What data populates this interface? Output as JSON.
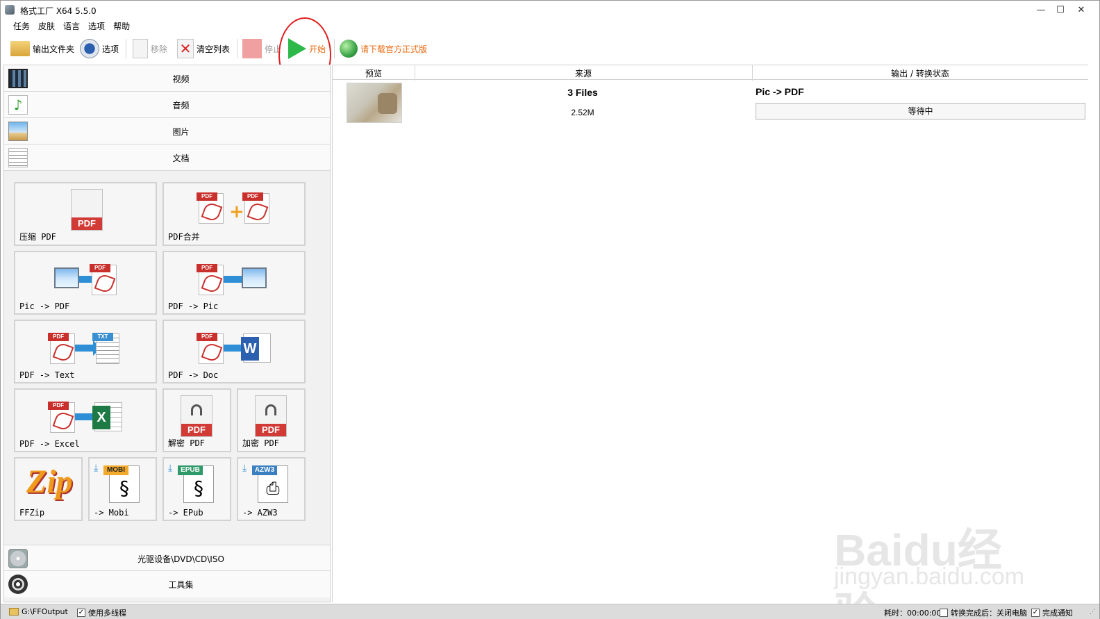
{
  "window": {
    "title": "格式工厂 X64 5.5.0",
    "minimize": "—",
    "maximize": "☐",
    "close": "✕"
  },
  "menu": [
    "任务",
    "皮肤",
    "语言",
    "选项",
    "帮助"
  ],
  "toolbar": {
    "output_folder": "输出文件夹",
    "options": "选项",
    "remove": "移除",
    "clear_list": "清空列表",
    "stop": "停止",
    "start": "开始",
    "download": "请下载官方正式版"
  },
  "categories": {
    "video": "视频",
    "audio": "音频",
    "image": "图片",
    "document": "文档",
    "disc": "光驱设备\\DVD\\CD\\ISO",
    "tools": "工具集"
  },
  "tiles": {
    "compress_pdf": "压缩 PDF",
    "pdf_merge": "PDF合并",
    "pic_to_pdf": "Pic -> PDF",
    "pdf_to_pic": "PDF -> Pic",
    "pdf_to_text": "PDF -> Text",
    "pdf_to_doc": "PDF -> Doc",
    "pdf_to_excel": "PDF -> Excel",
    "decrypt_pdf": "解密 PDF",
    "encrypt_pdf": "加密 PDF",
    "ffzip": "FFZip",
    "to_mobi": "-> Mobi",
    "to_epub": "-> EPub",
    "to_azw3": "-> AZW3"
  },
  "badges": {
    "pdf": "PDF",
    "txt": "TXT",
    "word": "W",
    "excel": "X",
    "mobi": "MOBI",
    "epub": "EPUB",
    "azw3": "AZW3",
    "zip": "Zip"
  },
  "table": {
    "headers": {
      "preview": "预览",
      "source": "来源",
      "output": "输出 / 转换状态"
    },
    "rows": [
      {
        "source_files": "3 Files",
        "size": "2.52M",
        "output_type": "Pic -> PDF",
        "status": "等待中"
      }
    ]
  },
  "status": {
    "output_path": "G:\\FFOutput",
    "multithread": "使用多线程",
    "elapsed": "耗时：00:00:00",
    "after_convert": "转换完成后：关闭电脑",
    "notify": "完成通知"
  },
  "watermark": {
    "logo": "Baidu经验",
    "url": "jingyan.baidu.com"
  },
  "colors": {
    "start_green": "#2db84a",
    "download_orange": "#e86a10",
    "pdf_red": "#c9302c",
    "annotation_red": "#e01e1e"
  }
}
